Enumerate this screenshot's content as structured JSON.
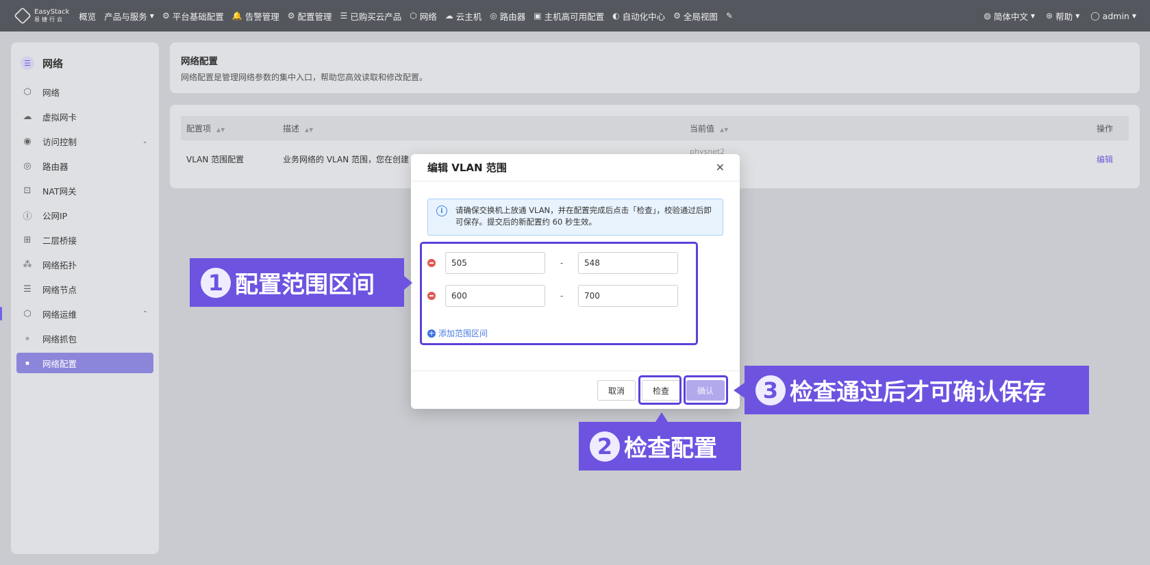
{
  "topnav": {
    "brand": {
      "name": "EasyStack",
      "sub": "易捷行云"
    },
    "items": [
      {
        "label": "概览",
        "icon": "",
        "dropdown": false
      },
      {
        "label": "产品与服务",
        "icon": "",
        "dropdown": true
      },
      {
        "label": "平台基础配置",
        "icon": "⚙",
        "dropdown": false
      },
      {
        "label": "告警管理",
        "icon": "🔔",
        "dropdown": false
      },
      {
        "label": "配置管理",
        "icon": "⚙",
        "dropdown": false
      },
      {
        "label": "已购买云产品",
        "icon": "☰",
        "dropdown": false
      },
      {
        "label": "网络",
        "icon": "⬡",
        "dropdown": false
      },
      {
        "label": "云主机",
        "icon": "☁",
        "dropdown": false
      },
      {
        "label": "路由器",
        "icon": "◎",
        "dropdown": false
      },
      {
        "label": "主机高可用配置",
        "icon": "▣",
        "dropdown": false
      },
      {
        "label": "自动化中心",
        "icon": "◐",
        "dropdown": false
      },
      {
        "label": "全局视图",
        "icon": "⚙",
        "dropdown": false
      }
    ],
    "pin_icon": "✎",
    "right": {
      "language": "简体中文",
      "help": "帮助",
      "user": "admin"
    }
  },
  "sidebar": {
    "title": "网络",
    "items": [
      {
        "label": "网络",
        "icon": "⬡"
      },
      {
        "label": "虚拟网卡",
        "icon": "☁"
      },
      {
        "label": "访问控制",
        "icon": "◉",
        "chevron": "⌄"
      },
      {
        "label": "路由器",
        "icon": "◎"
      },
      {
        "label": "NAT网关",
        "icon": "⊡"
      },
      {
        "label": "公网IP",
        "icon": "Ⓘ"
      },
      {
        "label": "二层桥接",
        "icon": "⊞"
      },
      {
        "label": "网络拓扑",
        "icon": "⁂"
      },
      {
        "label": "网络节点",
        "icon": "☰"
      },
      {
        "label": "网络运维",
        "icon": "⬡",
        "chevron": "⌃"
      },
      {
        "label": "网络抓包",
        "icon": "■"
      },
      {
        "label": "网络配置",
        "icon": "■"
      }
    ]
  },
  "page": {
    "title": "网络配置",
    "description": "网络配置是管理网络参数的集中入口，帮助您高效读取和修改配置。"
  },
  "table": {
    "columns": [
      "配置项",
      "描述",
      "当前值",
      "操作"
    ],
    "rows": [
      {
        "name": "VLAN 范围配置",
        "description": "业务网络的 VLAN 范围，您在创建 V",
        "current": "physnet2",
        "action": "编辑"
      }
    ]
  },
  "modal": {
    "title": "编辑 VLAN 范围",
    "alert": "请确保交换机上放通 VLAN，并在配置完成后点击「检查」，校验通过后即可保存。提交后的新配置约 60 秒生效。",
    "ranges": [
      {
        "start": "505",
        "end": "548"
      },
      {
        "start": "600",
        "end": "700"
      }
    ],
    "separator": "-",
    "add_label": "添加范围区间",
    "buttons": {
      "cancel": "取消",
      "check": "检查",
      "confirm": "确认"
    }
  },
  "callouts": [
    {
      "num": "1",
      "text": "配置范围区间"
    },
    {
      "num": "2",
      "text": "检查配置"
    },
    {
      "num": "3",
      "text": "检查通过后才可确认保存"
    }
  ],
  "colors": {
    "accent": "#6d53e0",
    "nav_bg": "#54575d",
    "danger": "#e05a52",
    "info": "#3a84e8"
  }
}
